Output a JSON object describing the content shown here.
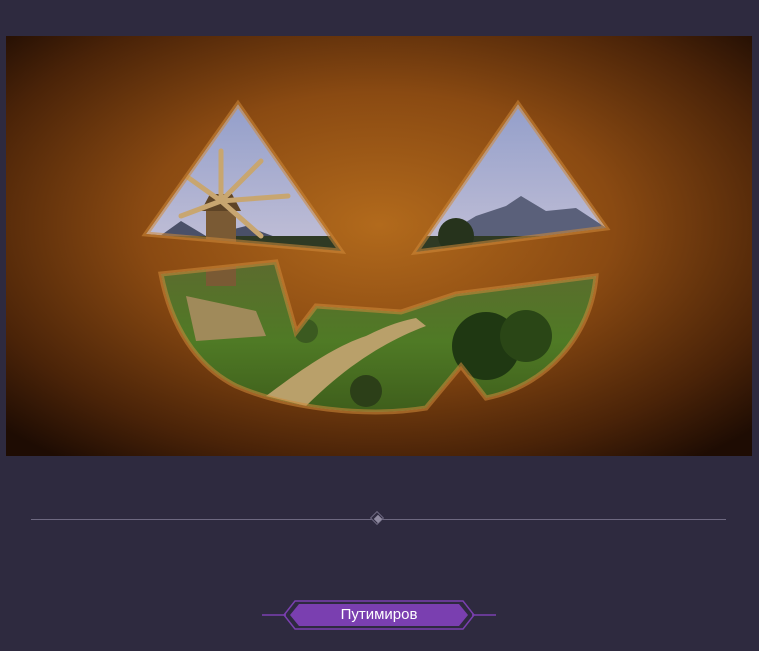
{
  "hero": {
    "icon": "jack-o-lantern-windmill-scene"
  },
  "divider": {
    "icon": "diamond-icon"
  },
  "tag": {
    "label": "Путимиров",
    "accent": "#7a3fb0"
  },
  "colors": {
    "background": "#2e2a3f",
    "divider": "#6d6880",
    "tag_fill": "#7a3fb0"
  }
}
